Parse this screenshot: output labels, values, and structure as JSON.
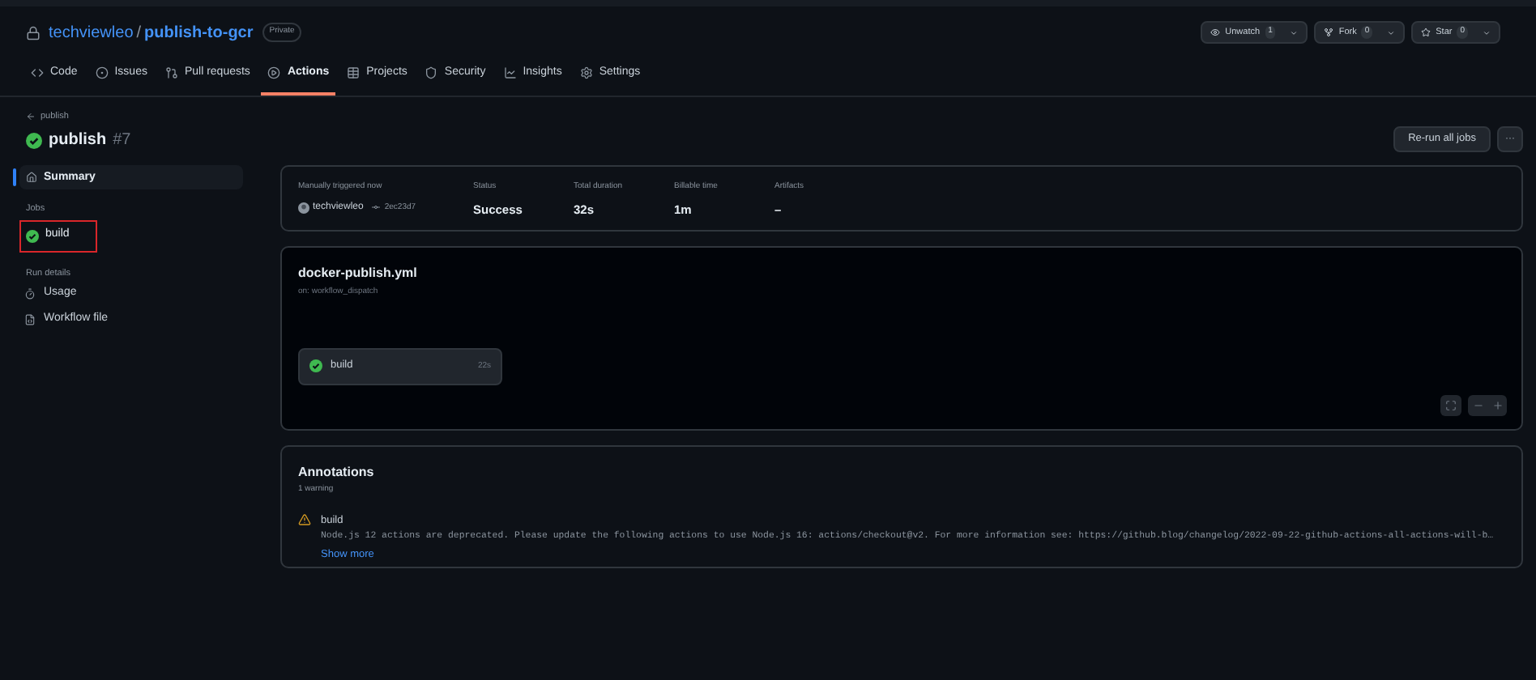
{
  "repo": {
    "owner": "techviewleo",
    "separator": "/",
    "name": "publish-to-gcr",
    "visibility": "Private"
  },
  "repo_actions": [
    {
      "kind": "watch",
      "label": "Unwatch",
      "count": "1"
    },
    {
      "kind": "fork",
      "label": "Fork",
      "count": "0"
    },
    {
      "kind": "star",
      "label": "Star",
      "count": "0"
    }
  ],
  "tabs": [
    {
      "kind": "code",
      "label": "Code",
      "selected": false
    },
    {
      "kind": "issues",
      "label": "Issues",
      "selected": false
    },
    {
      "kind": "pulls",
      "label": "Pull requests",
      "selected": false
    },
    {
      "kind": "actions",
      "label": "Actions",
      "selected": true
    },
    {
      "kind": "projects",
      "label": "Projects",
      "selected": false
    },
    {
      "kind": "security",
      "label": "Security",
      "selected": false
    },
    {
      "kind": "insights",
      "label": "Insights",
      "selected": false
    },
    {
      "kind": "settings",
      "label": "Settings",
      "selected": false
    }
  ],
  "breadcrumb": "publish",
  "run": {
    "title": "publish",
    "number": "#7",
    "rerun_button": "Re-run all jobs",
    "more_button": "···"
  },
  "sidebar": {
    "summary": {
      "label": "Summary",
      "selected": true
    },
    "jobs_heading": "Jobs",
    "jobs": [
      {
        "label": "build",
        "highlighted": true
      }
    ],
    "details_heading": "Run details",
    "details": [
      {
        "kind": "usage",
        "label": "Usage"
      },
      {
        "kind": "file",
        "label": "Workflow file"
      }
    ]
  },
  "summary": {
    "trigger_label": "Manually triggered now",
    "actor": "techviewleo",
    "commit": "2ec23d7",
    "stats": [
      {
        "label": "Status",
        "value": "Success"
      },
      {
        "label": "Total duration",
        "value": "32s"
      },
      {
        "label": "Billable time",
        "value": "1m"
      },
      {
        "label": "Artifacts",
        "value": "–"
      }
    ]
  },
  "workflow": {
    "file": "docker-publish.yml",
    "trigger": "on: workflow_dispatch",
    "job": {
      "name": "build",
      "duration": "22s"
    }
  },
  "annotations": {
    "title": "Annotations",
    "count": "1 warning",
    "items": [
      {
        "job": "build",
        "message": "Node.js 12 actions are deprecated. Please update the following actions to use Node.js 16: actions/checkout@v2. For more information see: https://github.blog/changelog/2022-09-22-github-actions-all-actions-will-b…",
        "link": "Show more"
      }
    ]
  }
}
